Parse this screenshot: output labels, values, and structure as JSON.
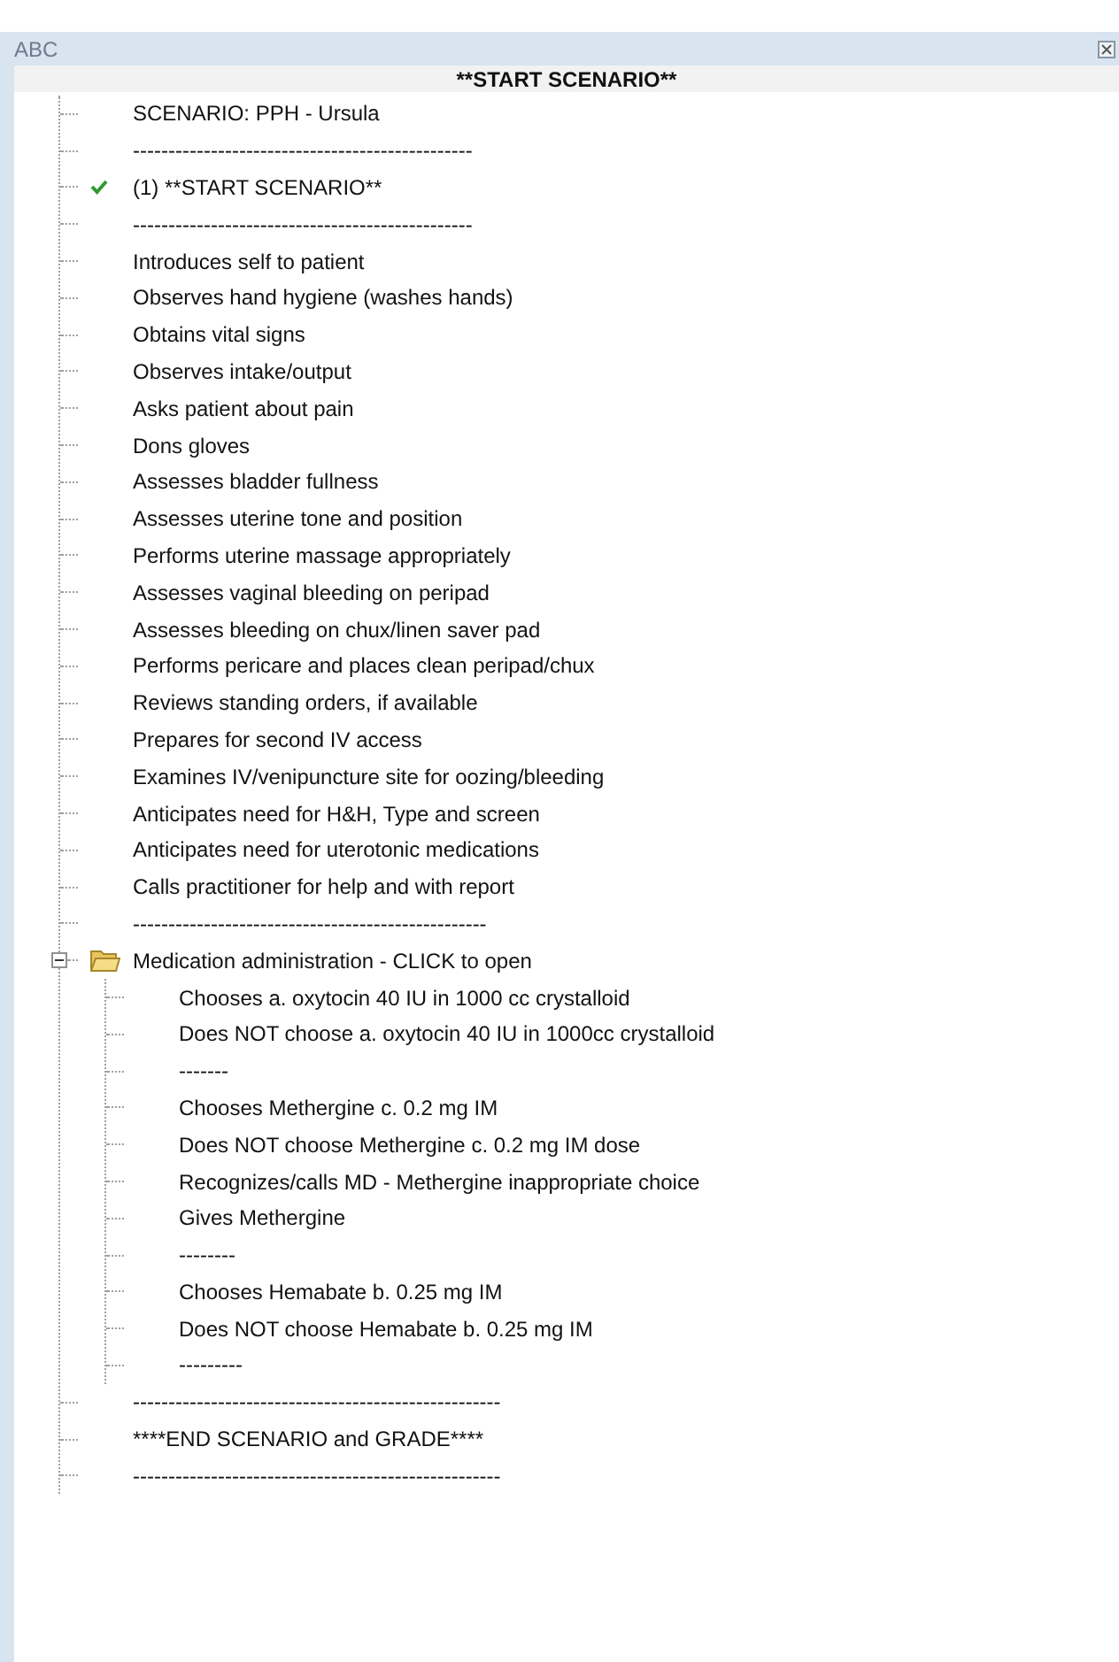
{
  "window": {
    "title": "ABC"
  },
  "header": "**START SCENARIO**",
  "tree": {
    "items": [
      {
        "label": "SCENARIO:  PPH - Ursula",
        "checked": false
      },
      {
        "label": "------------------------------------------------",
        "checked": false
      },
      {
        "label": "(1) **START SCENARIO**",
        "checked": true
      },
      {
        "label": "------------------------------------------------",
        "checked": false
      },
      {
        "label": "Introduces self to patient",
        "checked": false
      },
      {
        "label": "Observes hand hygiene (washes hands)",
        "checked": false
      },
      {
        "label": "Obtains vital signs",
        "checked": false
      },
      {
        "label": "Observes intake/output",
        "checked": false
      },
      {
        "label": "Asks patient about pain",
        "checked": false
      },
      {
        "label": "Dons gloves",
        "checked": false
      },
      {
        "label": "Assesses bladder fullness",
        "checked": false
      },
      {
        "label": "Assesses uterine tone and position",
        "checked": false
      },
      {
        "label": "Performs uterine massage appropriately",
        "checked": false
      },
      {
        "label": "Assesses vaginal bleeding on peripad",
        "checked": false
      },
      {
        "label": "Assesses bleeding on chux/linen saver pad",
        "checked": false
      },
      {
        "label": "Performs pericare and places clean peripad/chux",
        "checked": false
      },
      {
        "label": "Reviews standing orders, if available",
        "checked": false
      },
      {
        "label": "Prepares for second IV access",
        "checked": false
      },
      {
        "label": "Examines IV/venipuncture site for oozing/bleeding",
        "checked": false
      },
      {
        "label": "Anticipates need for H&H, Type and screen",
        "checked": false
      },
      {
        "label": "Anticipates need for uterotonic medications",
        "checked": false
      },
      {
        "label": "Calls practitioner for help and with report",
        "checked": false
      },
      {
        "label": "--------------------------------------------------",
        "checked": false
      },
      {
        "label": "Medication administration - CLICK to open",
        "checked": false,
        "expanded": true,
        "children": [
          {
            "label": "Chooses a. oxytocin 40 IU in 1000 cc crystalloid",
            "checked": false
          },
          {
            "label": "Does NOT choose a. oxytocin 40 IU in 1000cc crystalloid",
            "checked": false
          },
          {
            "label": "-------",
            "checked": false
          },
          {
            "label": "Chooses Methergine c. 0.2 mg IM",
            "checked": false
          },
          {
            "label": "Does NOT choose Methergine c. 0.2 mg IM dose",
            "checked": false
          },
          {
            "label": "Recognizes/calls MD - Methergine inappropriate choice",
            "checked": false
          },
          {
            "label": "Gives Methergine",
            "checked": false
          },
          {
            "label": "--------",
            "checked": false
          },
          {
            "label": "Chooses Hemabate b. 0.25 mg IM",
            "checked": false
          },
          {
            "label": "Does NOT choose Hemabate b. 0.25 mg IM",
            "checked": false
          },
          {
            "label": "---------",
            "checked": false
          }
        ]
      },
      {
        "label": "----------------------------------------------------",
        "checked": false
      },
      {
        "label": "****END SCENARIO and GRADE****",
        "checked": false
      },
      {
        "label": "----------------------------------------------------",
        "checked": false
      }
    ]
  }
}
